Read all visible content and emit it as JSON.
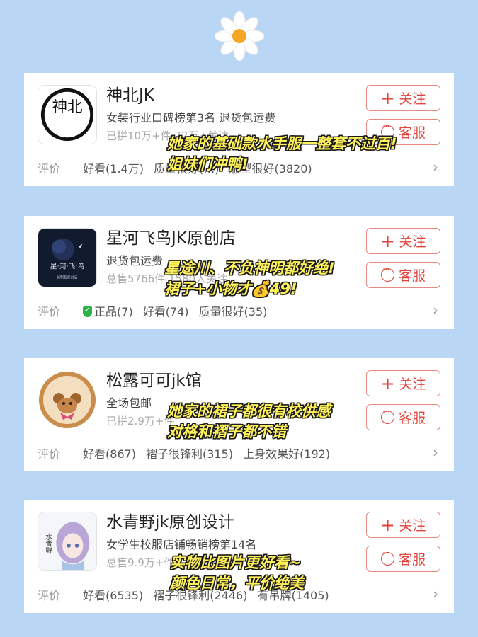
{
  "decoration": {
    "icon": "daisy-flower-icon"
  },
  "shops": [
    {
      "name": "神北JK",
      "line2": "女装行业口碑榜第3名  退货包运费",
      "line3": "已拼10万+件  72万+关注",
      "follow_label": "关注",
      "service_label": "客服",
      "review_label": "评价",
      "review_tags": [
        "好看(1.4万)",
        "质量很好(…)",
        "版型很好(3820)"
      ],
      "caption_lines": [
        "她家的基础款水手服一整套不过百!",
        "姐妹们冲鸭!"
      ],
      "logo_text": "神北"
    },
    {
      "name": "星河飞鸟JK原创店",
      "line2": "退货包运费",
      "line3": "总售5766件  1580人关注",
      "follow_label": "关注",
      "service_label": "客服",
      "review_label": "评价",
      "review_tags": [
        "正品(7)",
        "好看(74)",
        "质量很好(35)"
      ],
      "caption_lines": [
        "星途川、不负神明都好绝!",
        "裙子+小物才💰49!"
      ],
      "logo_text": "星·河·飞·鸟",
      "logo_subtext": "JK制服原创店"
    },
    {
      "name": "松露可可jk馆",
      "line2": "全场包邮",
      "line3": "已拼2.9万+件",
      "follow_label": "关注",
      "service_label": "客服",
      "review_label": "评价",
      "review_tags": [
        "好看(867)",
        "褶子很锋利(315)",
        "上身效果好(192)"
      ],
      "caption_lines": [
        "她家的裙子都很有校供感",
        "对格和褶子都不错"
      ]
    },
    {
      "name": "水青野jk原创设计",
      "line2": "女学生校服店铺畅销榜第14名",
      "line3": "总售9.9万+件",
      "follow_label": "关注",
      "service_label": "客服",
      "review_label": "评价",
      "review_tags": [
        "好看(6535)",
        "褶子很锋利(2446)",
        "有吊牌(1405)"
      ],
      "caption_lines": [
        "实物比图片更好看~",
        "颜色日常，平价绝美"
      ],
      "logo_text": "水青野"
    }
  ],
  "colors": {
    "background": "#b9d6f5",
    "accent_red": "#e2433a",
    "caption_yellow": "#fff15a",
    "verified_green": "#2eb24a"
  }
}
